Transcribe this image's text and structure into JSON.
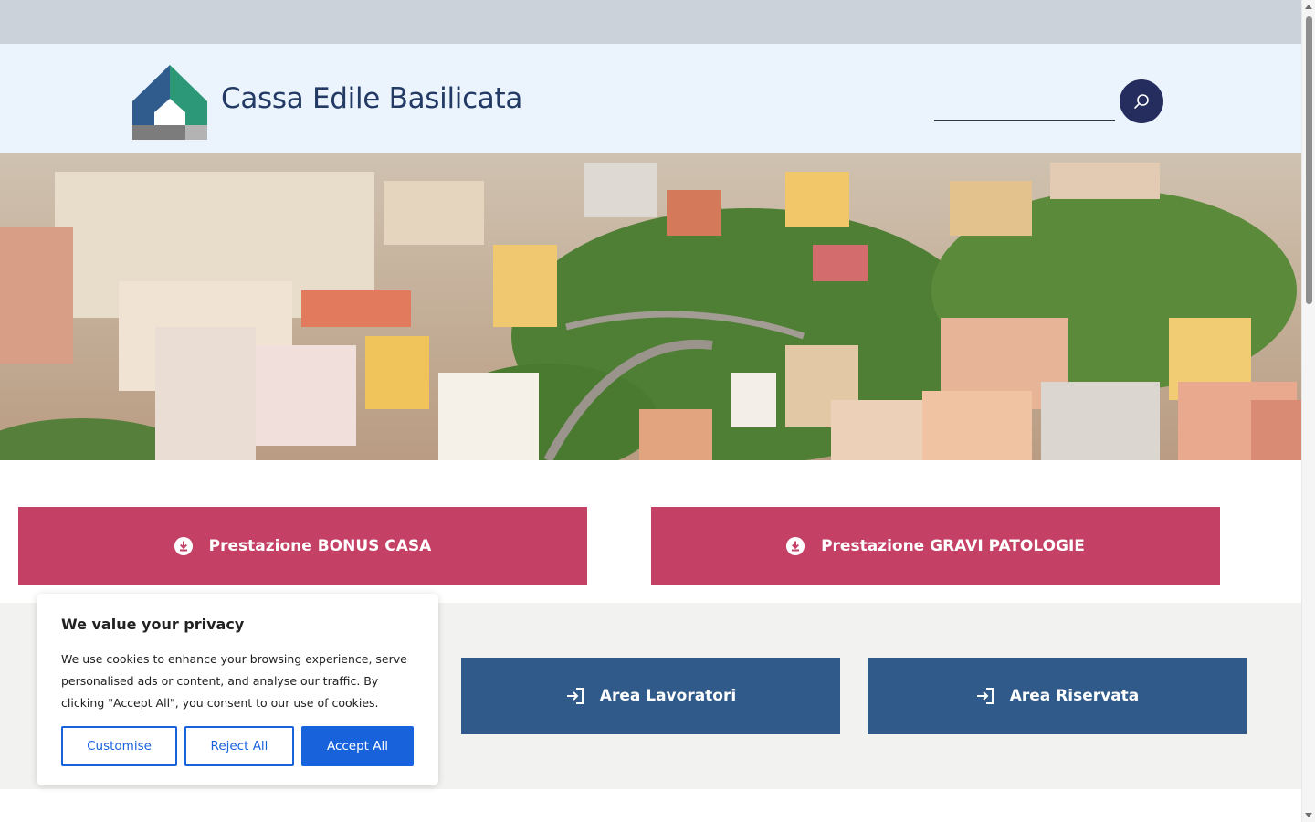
{
  "header": {
    "site_title": "Cassa Edile Basilicata",
    "logo_icon": "house-logo-icon",
    "search": {
      "placeholder": "",
      "button_icon": "search-icon"
    }
  },
  "hero": {
    "description_icon": "city-aerial-photo"
  },
  "downloads": [
    {
      "label": "Prestazione BONUS CASA",
      "icon": "download-circle-icon"
    },
    {
      "label": "Prestazione GRAVI PATOLOGIE",
      "icon": "download-circle-icon"
    }
  ],
  "areas": [
    {
      "label": "Area Lavoratori",
      "icon": "sign-in-icon"
    },
    {
      "label": "Area Riservata",
      "icon": "sign-in-icon"
    }
  ],
  "cookie_banner": {
    "title": "We value your privacy",
    "text": "We use cookies to enhance your browsing experience, serve personalised ads or content, and analyse our traffic. By clicking \"Accept All\", you consent to our use of cookies.",
    "customise_label": "Customise",
    "reject_label": "Reject All",
    "accept_label": "Accept All"
  },
  "colors": {
    "brand_dark": "#233a64",
    "download_button": "#c44065",
    "area_button": "#2f5a8a",
    "cookie_accent": "#1863dc",
    "header_bg": "#ebf4fd"
  }
}
